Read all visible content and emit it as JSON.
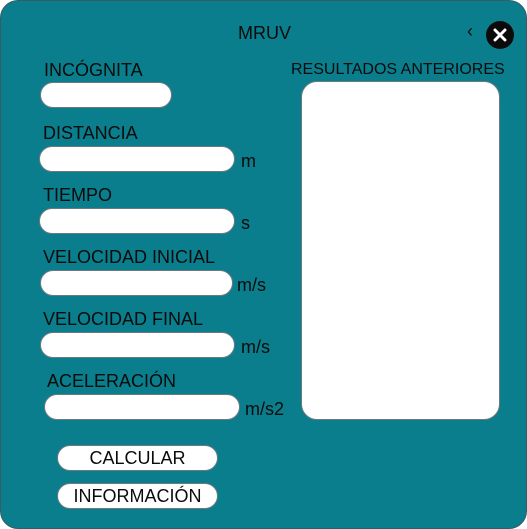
{
  "window": {
    "title": "MRUV",
    "back_glyph": "‹"
  },
  "form": {
    "incognita_label": "INCÓGNITA",
    "distancia_label": "DISTANCIA",
    "distancia_unit": "m",
    "tiempo_label": "TIEMPO",
    "tiempo_unit": "s",
    "velocidad_inicial_label": "VELOCIDAD INICIAL",
    "velocidad_inicial_unit": "m/s",
    "velocidad_final_label": "VELOCIDAD FINAL",
    "velocidad_final_unit": "m/s",
    "aceleracion_label": "ACELERACIÓN",
    "aceleracion_unit": "m/s2"
  },
  "results": {
    "label": "RESULTADOS ANTERIORES"
  },
  "buttons": {
    "calcular": "CALCULAR",
    "informacion": "INFORMACIÓN"
  },
  "icons": {
    "back": "chevron-left-icon",
    "close": "close-icon"
  },
  "colors": {
    "background": "#0a7e8c",
    "field": "#ffffff",
    "text": "#0b0b0b"
  }
}
